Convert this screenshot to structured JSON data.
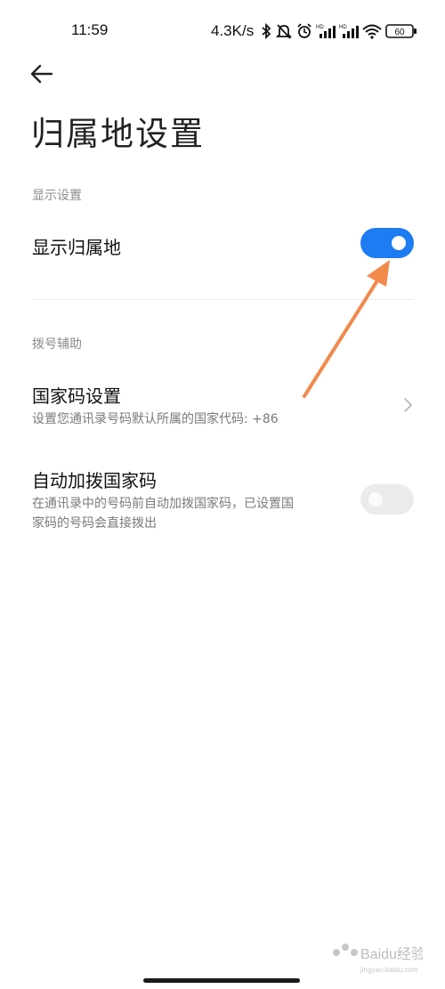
{
  "status_bar": {
    "time": "11:59",
    "net_speed": "4.3K/s",
    "battery": "60"
  },
  "header": {
    "title": "归属地设置"
  },
  "sections": [
    {
      "label": "显示设置",
      "items": [
        {
          "title": "显示归属地",
          "toggle": "on"
        }
      ]
    },
    {
      "label": "拨号辅助",
      "items": [
        {
          "title": "国家码设置",
          "subtitle": "设置您通讯录号码默认所属的国家代码: +86"
        },
        {
          "title": "自动加拨国家码",
          "subtitle_line1": "在通讯录中的号码前自动加拨国家码，已设置国",
          "subtitle_line2": "家码的号码会直接拨出",
          "toggle": "off"
        }
      ]
    }
  ],
  "colors": {
    "toggle_on": "#1d7cf2",
    "toggle_off": "#ebebeb",
    "annotation_arrow": "#f28a4c"
  },
  "watermark": {
    "text": "Baidu经验",
    "sub": "jingyan.baidu.com"
  }
}
